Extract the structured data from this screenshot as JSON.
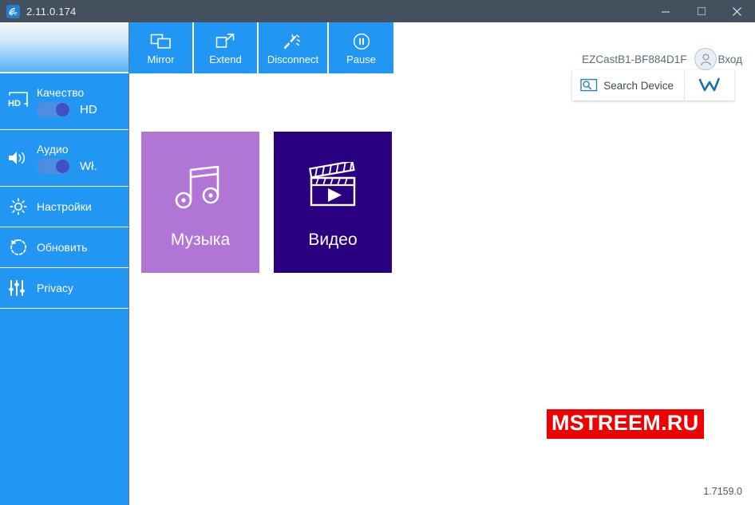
{
  "window": {
    "title": "2.11.0.174",
    "app_icon": "ezcast-logo-icon",
    "controls": {
      "minimize": "minimize-icon",
      "maximize": "maximize-icon",
      "close": "close-icon"
    }
  },
  "sidebar": {
    "items": [
      {
        "id": "quality",
        "icon": "hd-quality-icon",
        "label": "Качество",
        "type": "toggle",
        "toggle_state": "on",
        "value": "HD"
      },
      {
        "id": "audio",
        "icon": "speaker-volume-icon",
        "label": "Аудио",
        "type": "toggle",
        "toggle_state": "on",
        "value": "Wł."
      },
      {
        "id": "settings",
        "icon": "gear-icon",
        "label": "Настройки",
        "type": "simple"
      },
      {
        "id": "update",
        "icon": "refresh-icon",
        "label": "Обновить",
        "type": "simple"
      },
      {
        "id": "privacy",
        "icon": "sliders-icon",
        "label": "Privacy",
        "type": "simple"
      }
    ]
  },
  "toolbar": {
    "tabs": [
      {
        "id": "mirror",
        "label": "Mirror",
        "icon": "mirror-screens-icon"
      },
      {
        "id": "extend",
        "label": "Extend",
        "icon": "extend-screen-icon"
      },
      {
        "id": "disconnect",
        "label": "Disconnect",
        "icon": "disconnect-wand-icon"
      },
      {
        "id": "pause",
        "label": "Pause",
        "icon": "pause-circle-icon"
      }
    ]
  },
  "account": {
    "device_name": "EZCastB1-BF884D1F",
    "avatar_icon": "user-avatar-icon",
    "login_label": "Вход"
  },
  "actions": {
    "search_device": {
      "label": "Search Device",
      "icon": "search-device-icon"
    },
    "w_button": {
      "icon": "w-logo-icon"
    }
  },
  "content": {
    "tiles": [
      {
        "id": "music",
        "label": "Музыка",
        "icon": "music-note-icon",
        "color": "#b175d6"
      },
      {
        "id": "video",
        "label": "Видео",
        "icon": "film-clapper-icon",
        "color": "#2b0080"
      }
    ]
  },
  "watermark": {
    "text": "MSTREEM.RU",
    "color": "#ee0000"
  },
  "footer": {
    "version": "1.7159.0"
  },
  "colors": {
    "titlebar": "#44505e",
    "sidebar": "#2196f3",
    "accent": "#2196f3",
    "music_tile": "#b175d6",
    "video_tile": "#2b0080"
  }
}
